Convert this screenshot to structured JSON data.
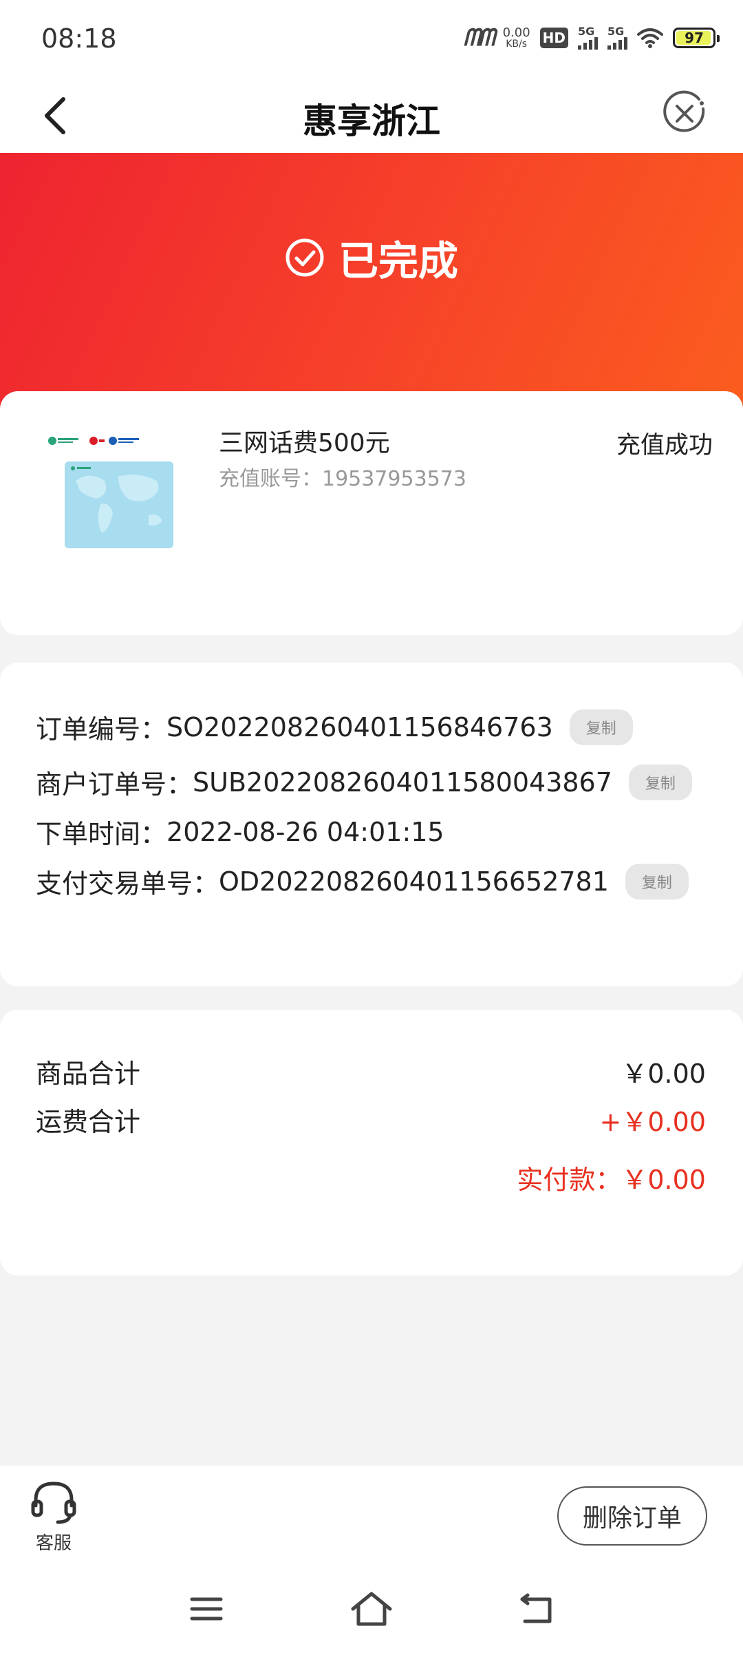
{
  "status_bar": {
    "time": "08:18",
    "network_speed_value": "0.00",
    "network_speed_unit": "KB/s",
    "hd_label": "HD",
    "signal1": "5G",
    "signal2": "5G",
    "battery": "97",
    "battery_level": 0.97
  },
  "header": {
    "title": "惠享浙江"
  },
  "banner": {
    "status": "已完成"
  },
  "product": {
    "name": "三网话费500元",
    "account_label": "充值账号：",
    "account": "19537953573",
    "status": "充值成功"
  },
  "order_info": {
    "copy_label": "复制",
    "rows": [
      {
        "label": "订单编号：",
        "value": "SO20220826040115684​6763"
      },
      {
        "label": "商户订单号：",
        "value": "SUB20220826040115800438​67"
      },
      {
        "label": "下单时间：",
        "value": "2022-08-26 04:01:15"
      },
      {
        "label": "支付交易单号：",
        "value": "OD20220826040115665278​1"
      }
    ]
  },
  "amounts": {
    "goods_label": "商品合计",
    "goods_value": "￥0.00",
    "shipping_label": "运费合计",
    "shipping_value": "+￥0.00",
    "paid_label": "实付款：",
    "paid_value": "￥0.00"
  },
  "bottom": {
    "service_label": "客服",
    "delete_label": "删除订单"
  },
  "colors": {
    "accent_red": "#e8301f",
    "banner_start": "#ee2330",
    "banner_end": "#fb5d1e"
  },
  "icons": {
    "back": "back-arrow-icon",
    "close": "close-circle-icon",
    "check": "check-circle-icon",
    "service": "headset-icon",
    "nav_menu": "menu-icon",
    "nav_home": "home-icon",
    "nav_back": "return-icon"
  }
}
